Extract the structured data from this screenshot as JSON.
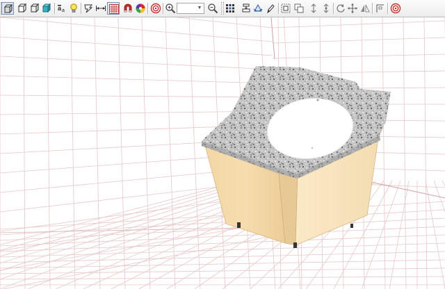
{
  "toolbar": {
    "left_tools": [
      {
        "name": "view-3d-solid-icon"
      },
      {
        "name": "view-box-front-icon"
      },
      {
        "name": "view-box-side-icon"
      },
      {
        "name": "view-box-color-icon"
      },
      {
        "name": "text-size-icon"
      },
      {
        "name": "light-bulb-icon"
      },
      {
        "name": "walk-through-icon"
      },
      {
        "name": "dimension-icon"
      },
      {
        "name": "grid-toggle-icon"
      },
      {
        "name": "magnet-snap-icon"
      },
      {
        "name": "color-wheel-icon"
      },
      {
        "name": "target-icon"
      },
      {
        "name": "zoom-in-icon"
      },
      {
        "name": "zoom-out-icon"
      }
    ],
    "right_tools": [
      {
        "name": "select-points-icon"
      },
      {
        "name": "align-center-icon"
      },
      {
        "name": "rotate-3d-icon"
      },
      {
        "name": "edit-pencil-icon"
      },
      {
        "name": "frame-select-icon"
      },
      {
        "name": "frame-group-icon"
      },
      {
        "name": "move-vertical-icon"
      },
      {
        "name": "move-vertical-alt-icon"
      },
      {
        "name": "rotate-icon"
      },
      {
        "name": "move-arrows-icon"
      },
      {
        "name": "mirror-icon"
      },
      {
        "name": "corner-icon"
      },
      {
        "name": "target-right-icon"
      }
    ],
    "zoom_value": "",
    "grid_active": true
  },
  "scene": {
    "countertop_color": "#bdbdbd",
    "cabinet_color": "#f4d9ac",
    "sink_color": "#ffffff",
    "grid_line_color": "#e8c7c7"
  }
}
